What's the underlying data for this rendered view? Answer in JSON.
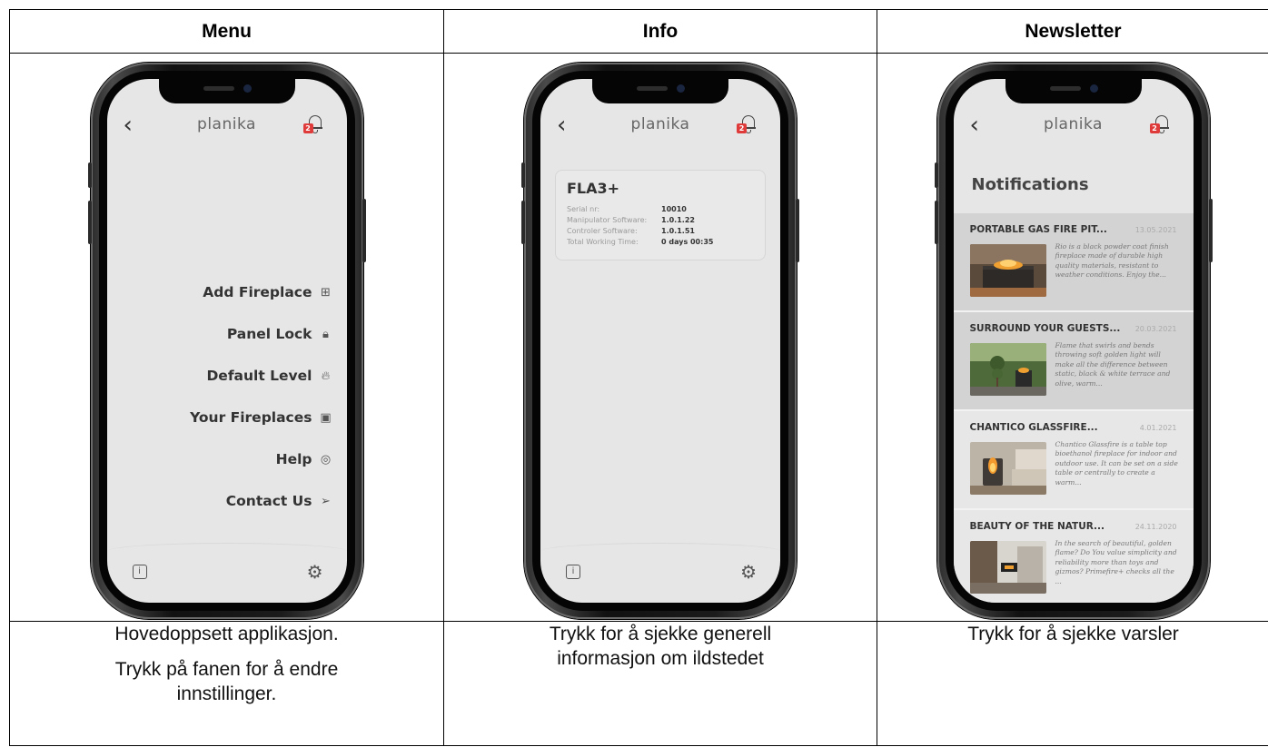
{
  "columns": [
    {
      "header": "Menu"
    },
    {
      "header": "Info"
    },
    {
      "header": "Newsletter"
    }
  ],
  "app": {
    "logo": "planika",
    "back": "‹",
    "badge_count": "2",
    "info_icon": "i",
    "settings_icon": "⚙"
  },
  "menu": {
    "items": [
      {
        "label": "Add Fireplace",
        "icon": "⊞"
      },
      {
        "label": "Panel Lock",
        "icon": "🔒︎"
      },
      {
        "label": "Default Level",
        "icon": "🔥︎"
      },
      {
        "label": "Your Fireplaces",
        "icon": "▣"
      },
      {
        "label": "Help",
        "icon": "◎"
      },
      {
        "label": "Contact Us",
        "icon": "➢"
      }
    ]
  },
  "info": {
    "model": "FLA3+",
    "rows": [
      {
        "key": "Serial nr:",
        "value": "10010"
      },
      {
        "key": "Manipulator Software:",
        "value": "1.0.1.22"
      },
      {
        "key": "Controler Software:",
        "value": "1.0.1.51"
      },
      {
        "key": "Total Working Time:",
        "value": "0 days  00:35"
      }
    ]
  },
  "notifications": {
    "title": "Notifications",
    "items": [
      {
        "title": "PORTABLE GAS FIRE PIT...",
        "date": "13.05.2021",
        "text": "Rio is a black powder coat finish fireplace made of durable high quality materials, resistant to weather conditions. Enjoy the..."
      },
      {
        "title": "SURROUND YOUR GUESTS...",
        "date": "20.03.2021",
        "text": "Flame that swirls and bends throwing soft golden light will make all the difference between static, black & white terrace and olive, warm..."
      },
      {
        "title": "CHANTICO GLASSFIRE...",
        "date": "4.01.2021",
        "text": "Chantico Glassfire is a table top bioethanol fireplace for indoor and outdoor use. It can be set on a side table or centrally to create a warm..."
      },
      {
        "title": "BEAUTY OF THE NATUR...",
        "date": "24.11.2020",
        "text": "In the search of beautiful, golden flame? Do You value simplicity and reliability more than toys and gizmos? Primefire+ checks all the ..."
      }
    ]
  },
  "captions": {
    "menu": [
      "Hovedoppsett applikasjon.",
      "Trykk på fanen for å endre innstillinger."
    ],
    "info": [
      "Trykk for å sjekke generell informasjon om ildstedet"
    ],
    "newsletter": [
      "Trykk for å sjekke varsler"
    ]
  }
}
